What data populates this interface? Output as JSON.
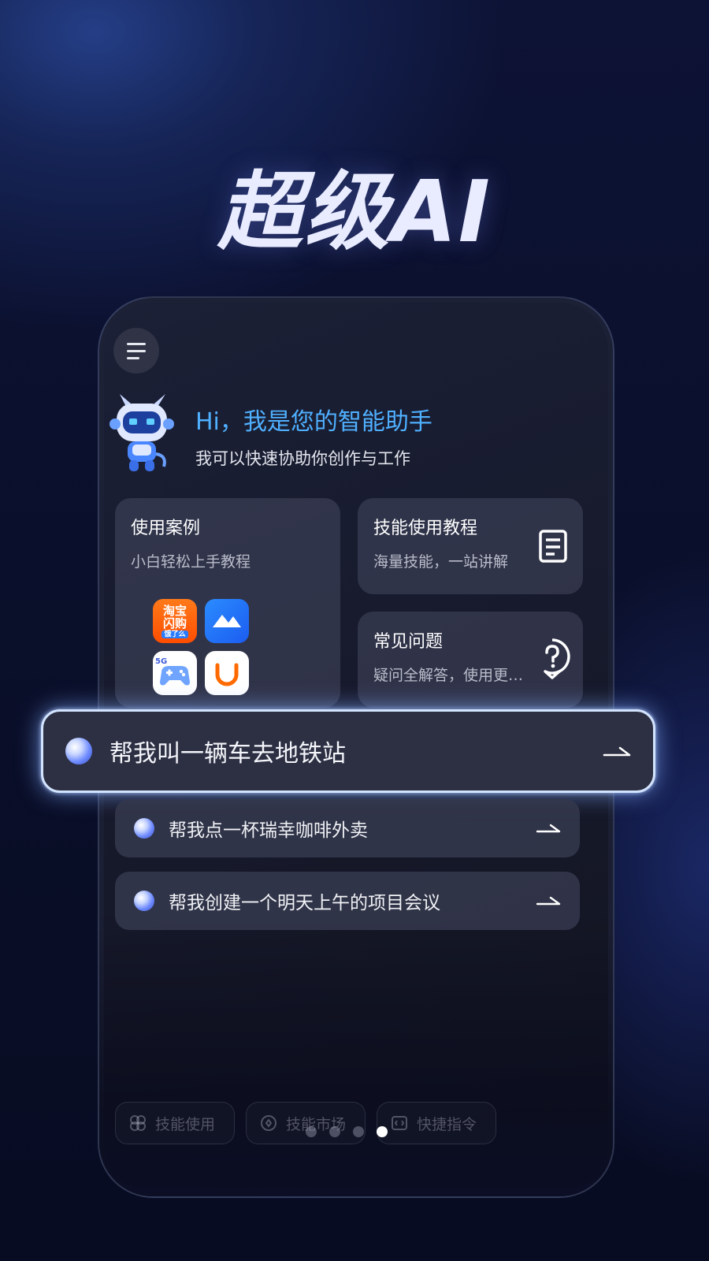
{
  "promo": {
    "title": "超级AI"
  },
  "header": {
    "greeting": "Hi，我是您的智能助手",
    "subtitle": "我可以快速协助你创作与工作"
  },
  "cards": {
    "cases": {
      "title": "使用案例",
      "subtitle": "小白轻松上手教程"
    },
    "skills": {
      "title": "技能使用教程",
      "subtitle": "海量技能，一站讲解"
    },
    "faq": {
      "title": "常见问题",
      "subtitle": "疑问全解答，使用更…"
    }
  },
  "apps": {
    "taobao_line1": "淘宝",
    "taobao_line2": "闪购",
    "taobao_tag": "饿了么"
  },
  "suggestions": {
    "highlighted": "帮我叫一辆车去地铁站",
    "items": [
      {
        "label": "帮我点一杯瑞幸咖啡外卖"
      },
      {
        "label": "帮我创建一个明天上午的项目会议"
      }
    ]
  },
  "bottom_bar": {
    "skill_use": "技能使用",
    "skill_market": "技能市场",
    "shortcut": "快捷指令"
  },
  "pager": {
    "count": 4,
    "active_index": 3
  },
  "colors": {
    "accent": "#4fb0ff",
    "background": "#0d1335",
    "highlight_border": "#d3e4ff"
  },
  "icons": [
    "menu-icon",
    "mascot-icon",
    "document-icon",
    "question-icon",
    "taobao-app-icon",
    "feishu-app-icon",
    "game-app-icon",
    "didi-app-icon",
    "orb-icon",
    "arrow-icon",
    "skill-icon",
    "market-icon",
    "shortcut-icon"
  ]
}
